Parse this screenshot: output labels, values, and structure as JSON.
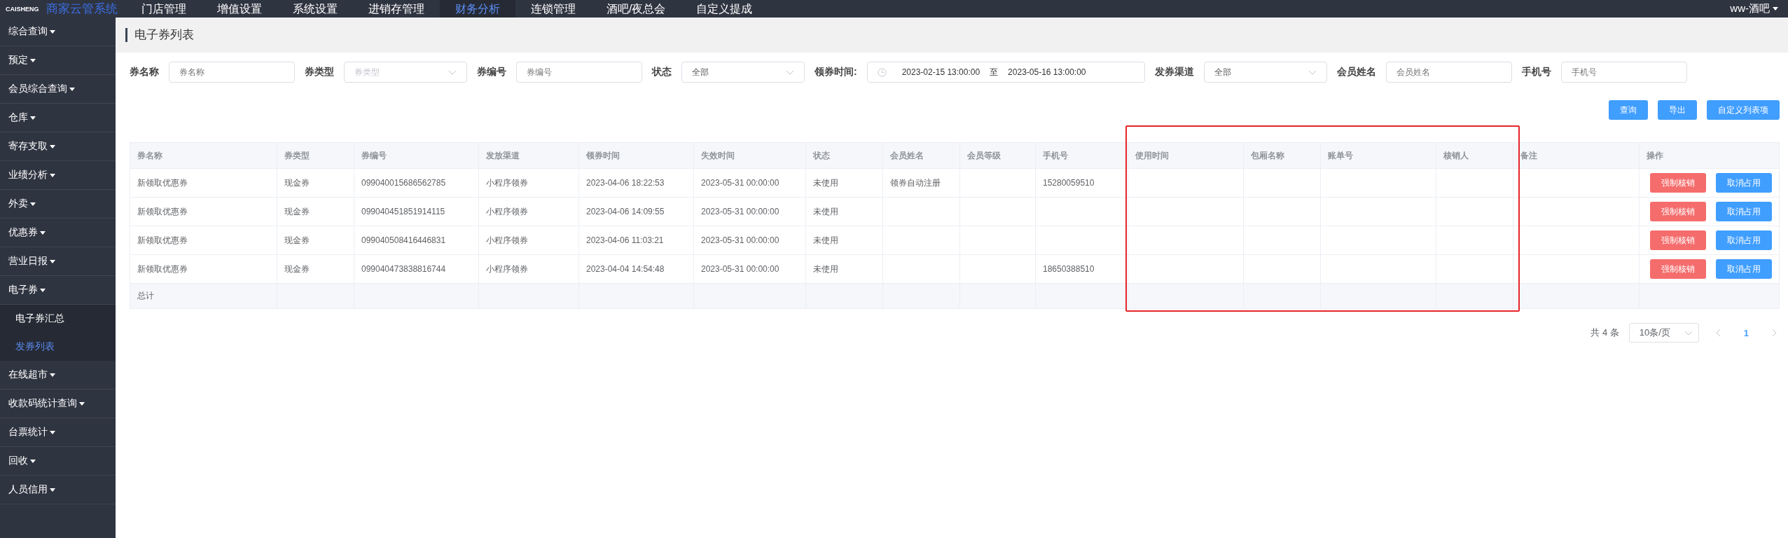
{
  "top_nav": {
    "logo_caption": "CAISHENG",
    "brand": "商家云管系统",
    "items": [
      {
        "label": "门店管理",
        "selected": false
      },
      {
        "label": "增值设置",
        "selected": false
      },
      {
        "label": "系统设置",
        "selected": false
      },
      {
        "label": "进销存管理",
        "selected": false
      },
      {
        "label": "财务分析",
        "selected": true
      },
      {
        "label": "连锁管理",
        "selected": false
      },
      {
        "label": "酒吧/夜总会",
        "selected": false
      },
      {
        "label": "自定义提成",
        "selected": false
      }
    ],
    "user": "ww-酒吧"
  },
  "sidebar": {
    "items": [
      {
        "label": "综合查询"
      },
      {
        "label": "预定"
      },
      {
        "label": "会员综合查询"
      },
      {
        "label": "仓库"
      },
      {
        "label": "寄存支取"
      },
      {
        "label": "业绩分析"
      },
      {
        "label": "外卖"
      },
      {
        "label": "优惠券"
      },
      {
        "label": "营业日报"
      },
      {
        "label": "电子券",
        "children": [
          {
            "label": "电子券汇总",
            "selected": false
          },
          {
            "label": "发券列表",
            "selected": true
          }
        ]
      },
      {
        "label": "在线超市"
      },
      {
        "label": "收款码统计查询"
      },
      {
        "label": "台票统计"
      },
      {
        "label": "回收"
      },
      {
        "label": "人员信用"
      }
    ]
  },
  "page_title": "电子券列表",
  "filters": [
    {
      "kind": "text",
      "label": "券名称",
      "placeholder": "券名称"
    },
    {
      "kind": "select",
      "label": "券类型",
      "placeholder": "券类型"
    },
    {
      "kind": "text",
      "label": "券编号",
      "placeholder": "券编号"
    },
    {
      "kind": "select",
      "label": "状态",
      "value": "全部"
    },
    {
      "kind": "daterange",
      "label": "领券时间:",
      "start": "2023-02-15 13:00:00",
      "separator": "至",
      "end": "2023-05-16 13:00:00"
    },
    {
      "kind": "select",
      "label": "发券渠道",
      "value": "全部"
    },
    {
      "kind": "text",
      "label": "会员姓名",
      "placeholder": "会员姓名"
    },
    {
      "kind": "text",
      "label": "手机号",
      "placeholder": "手机号"
    }
  ],
  "actions": [
    "查询",
    "导出",
    "自定义列表项"
  ],
  "table": {
    "columns": [
      "券名称",
      "券类型",
      "券编号",
      "发放渠道",
      "领券时间",
      "失效时间",
      "状态",
      "会员姓名",
      "会员等级",
      "手机号",
      "使用时间",
      "包厢名称",
      "账单号",
      "核销人",
      "备注",
      "操作"
    ],
    "rows": [
      {
        "name": "新领取优惠券",
        "type": "现金券",
        "code": "099040015686562785",
        "channel": "小程序领券",
        "received": "2023-04-06 18:22:53",
        "expires": "2023-05-31 00:00:00",
        "status": "未使用",
        "member_name": "领券自动注册",
        "phone": "15280059510",
        "ops": [
          {
            "label": "强制核销",
            "kind": "danger"
          },
          {
            "label": "取消占用",
            "kind": "primary"
          }
        ]
      },
      {
        "name": "新领取优惠券",
        "type": "现金券",
        "code": "099040451851914115",
        "channel": "小程序领券",
        "received": "2023-04-06 14:09:55",
        "expires": "2023-05-31 00:00:00",
        "status": "未使用",
        "ops": [
          {
            "label": "强制核销",
            "kind": "danger"
          },
          {
            "label": "取消占用",
            "kind": "primary"
          }
        ]
      },
      {
        "name": "新领取优惠券",
        "type": "现金券",
        "code": "099040508416446831",
        "channel": "小程序领券",
        "received": "2023-04-06 11:03:21",
        "expires": "2023-05-31 00:00:00",
        "status": "未使用",
        "ops": [
          {
            "label": "强制核销",
            "kind": "danger"
          },
          {
            "label": "取消占用",
            "kind": "primary"
          }
        ]
      },
      {
        "name": "新领取优惠券",
        "type": "现金券",
        "code": "099040473838816744",
        "channel": "小程序领券",
        "received": "2023-04-04 14:54:48",
        "expires": "2023-05-31 00:00:00",
        "status": "未使用",
        "phone": "18650388510",
        "ops": [
          {
            "label": "强制核销",
            "kind": "danger"
          },
          {
            "label": "取消占用",
            "kind": "primary"
          }
        ]
      }
    ],
    "total_row": {
      "label": "总计"
    }
  },
  "pagination": {
    "total": "共 4 条",
    "page_size": "10条/页",
    "pages": [
      {
        "label": "1",
        "selected": true
      }
    ]
  }
}
